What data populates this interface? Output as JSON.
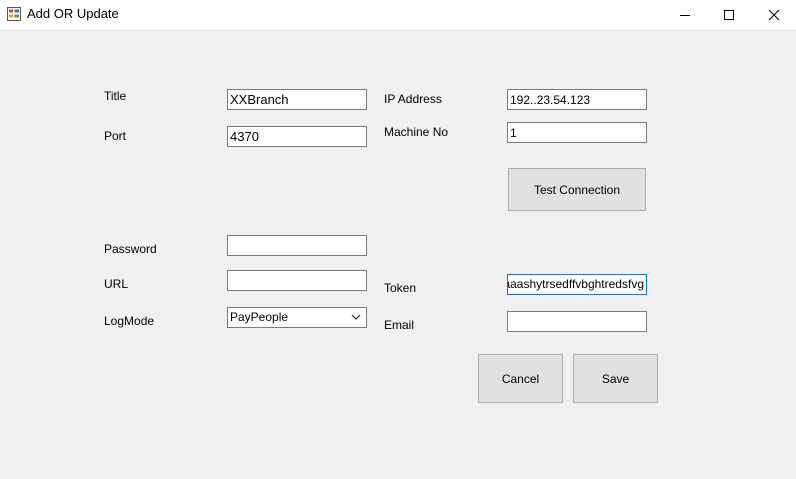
{
  "window": {
    "title": "Add OR Update",
    "icon": "app-form-icon",
    "controls": [
      "minimize-icon",
      "maximize-icon",
      "close-icon"
    ]
  },
  "form": {
    "title_label": "Title",
    "title_value": "XXBranch",
    "port_label": "Port",
    "port_value": "4370",
    "ip_label": "IP Address",
    "ip_value": "192..23.54.123",
    "machine_label": "Machine No",
    "machine_value": "1",
    "test_connection_label": "Test Connection",
    "password_label": "Password",
    "password_value": "",
    "url_label": "URL",
    "url_value": "",
    "logmode_label": "LogMode",
    "logmode_value": "PayPeople",
    "token_label": "Token",
    "token_value": "aaaaashytrsedffvbghtredsfvg",
    "email_label": "Email",
    "email_value": ""
  },
  "buttons": {
    "cancel": "Cancel",
    "save": "Save"
  }
}
